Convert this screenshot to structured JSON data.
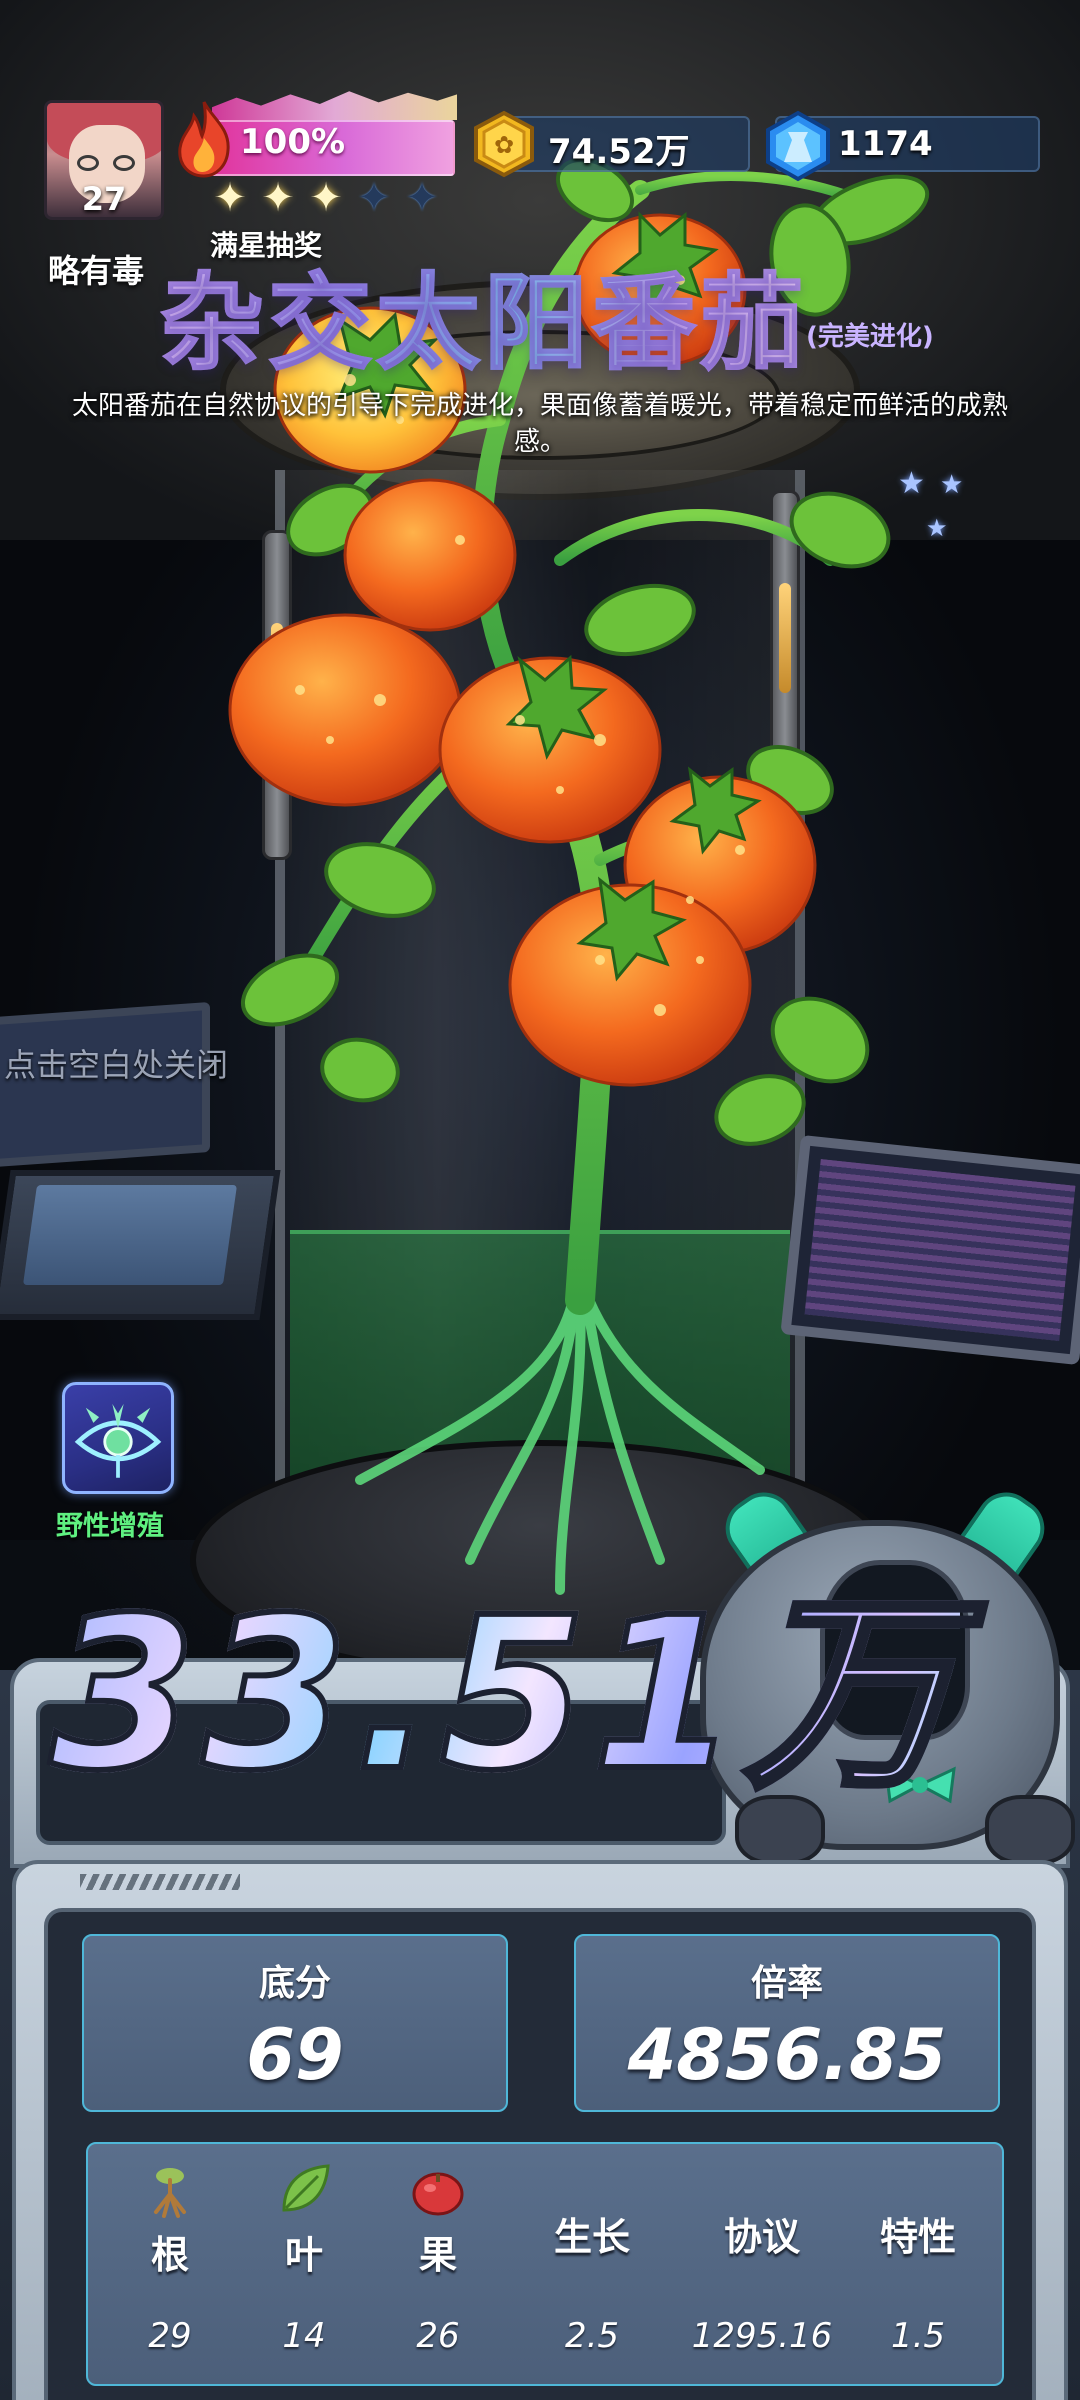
{
  "player": {
    "level": "27",
    "status": "略有毒"
  },
  "energy": {
    "percent_label": "100%",
    "fill_fraction": 1.0
  },
  "stars": {
    "filled": 3,
    "total": 5,
    "lottery_label": "满星抽奖"
  },
  "resources": {
    "coins": "74.52万",
    "gems": "1174"
  },
  "title": {
    "name": "杂交太阳番茄",
    "subtitle": "(完美进化)"
  },
  "description": "太阳番茄在自然协议的引导下完成进化，果面像蓄着暖光，带着稳定而鲜活的成熟感。",
  "close_hint": "点击空白处关闭",
  "wild_breeding": {
    "label": "野性增殖"
  },
  "score": {
    "total": "33.51万"
  },
  "stats": {
    "base_label": "底分",
    "base_value": "69",
    "multiplier_label": "倍率",
    "multiplier_value": "4856.85"
  },
  "attributes": [
    {
      "label": "根",
      "value": "29",
      "icon": "root-icon"
    },
    {
      "label": "叶",
      "value": "14",
      "icon": "leaf-icon"
    },
    {
      "label": "果",
      "value": "26",
      "icon": "fruit-icon"
    },
    {
      "label": "生长",
      "value": "2.5"
    },
    {
      "label": "协议",
      "value": "1295.16"
    },
    {
      "label": "特性",
      "value": "1.5"
    }
  ],
  "colors": {
    "accent_pink": "#e1349c",
    "card_border": "#4fb7d8",
    "wild_label": "#5ff080",
    "tomato": "#f46a1f"
  }
}
